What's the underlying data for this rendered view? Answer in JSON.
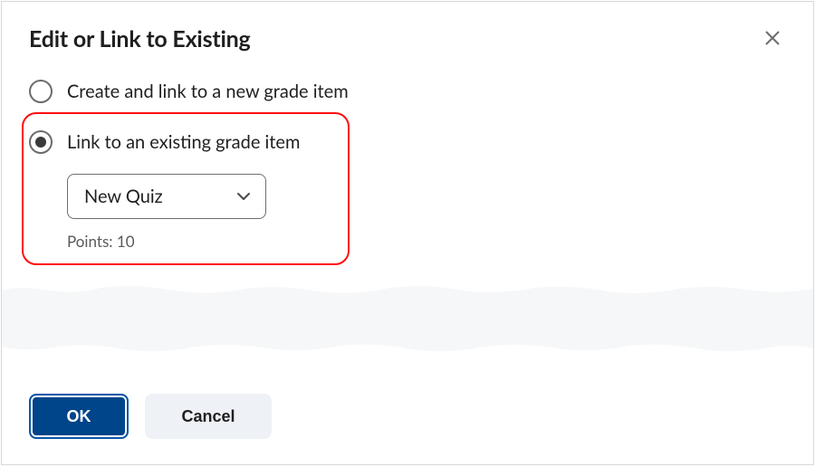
{
  "dialog": {
    "title": "Edit or Link to Existing"
  },
  "options": {
    "create_new": {
      "label": "Create and link to a new grade item",
      "selected": false
    },
    "link_existing": {
      "label": "Link to an existing grade item",
      "selected": true,
      "select_value": "New Quiz",
      "points_label": "Points: 10"
    }
  },
  "footer": {
    "ok_label": "OK",
    "cancel_label": "Cancel"
  }
}
